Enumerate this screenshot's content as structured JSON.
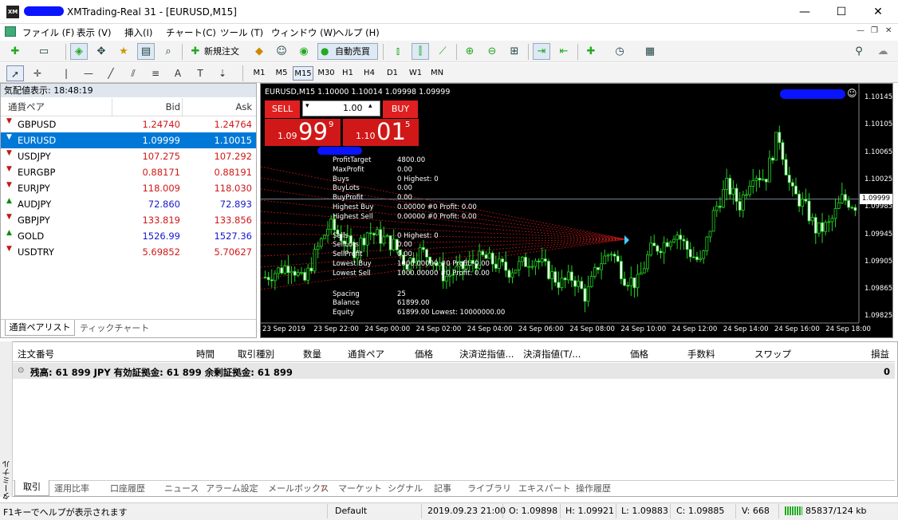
{
  "window": {
    "title": "XMTrading-Real 31 - [EURUSD,M15]",
    "app_icon": "XM",
    "minimize": "—",
    "maximize": "☐",
    "close": "✕"
  },
  "menu": [
    "ファイル (F)",
    "表示 (V)",
    "挿入(I)",
    "チャート(C)",
    "ツール (T)",
    "ウィンドウ (W)",
    "ヘルプ (H)"
  ],
  "toolbar": {
    "new_order": "新規注文",
    "auto_trading": "自動売買"
  },
  "timeframes": [
    "M1",
    "M5",
    "M15",
    "M30",
    "H1",
    "H4",
    "D1",
    "W1",
    "MN"
  ],
  "timeframe_selected": "M15",
  "market_watch": {
    "title": "気配値表示: 18:48:19",
    "col_symbol": "通貨ペア",
    "col_bid": "Bid",
    "col_ask": "Ask",
    "rows": [
      {
        "symbol": "GBPUSD",
        "bid": "1.24740",
        "ask": "1.24764",
        "dir": "down",
        "color": "red"
      },
      {
        "symbol": "EURUSD",
        "bid": "1.09999",
        "ask": "1.10015",
        "dir": "down",
        "color": "red",
        "selected": true
      },
      {
        "symbol": "USDJPY",
        "bid": "107.275",
        "ask": "107.292",
        "dir": "down",
        "color": "red"
      },
      {
        "symbol": "EURGBP",
        "bid": "0.88171",
        "ask": "0.88191",
        "dir": "down",
        "color": "red"
      },
      {
        "symbol": "EURJPY",
        "bid": "118.009",
        "ask": "118.030",
        "dir": "down",
        "color": "red"
      },
      {
        "symbol": "AUDJPY",
        "bid": "72.860",
        "ask": "72.893",
        "dir": "up",
        "color": "blue"
      },
      {
        "symbol": "GBPJPY",
        "bid": "133.819",
        "ask": "133.856",
        "dir": "down",
        "color": "red"
      },
      {
        "symbol": "GOLD",
        "bid": "1526.99",
        "ask": "1527.36",
        "dir": "up",
        "color": "blue"
      },
      {
        "symbol": "USDTRY",
        "bid": "5.69852",
        "ask": "5.70627",
        "dir": "down",
        "color": "red"
      }
    ],
    "tabs": [
      "通貨ペアリスト",
      "ティックチャート"
    ]
  },
  "chart": {
    "header": "EURUSD,M15  1.10000 1.10014 1.09998 1.09999",
    "sell_label": "SELL",
    "buy_label": "BUY",
    "lot": "1.00",
    "sell_small": "1.09",
    "sell_big": "99",
    "sell_sup": "9",
    "buy_small": "1.10",
    "buy_big": "01",
    "buy_sup": "5",
    "price_labels": [
      "1.10145",
      "1.10105",
      "1.10065",
      "1.10025",
      "1.09985",
      "1.09945",
      "1.09905",
      "1.09865",
      "1.09825"
    ],
    "current_price": "1.09999",
    "time_labels": [
      "23 Sep 2019",
      "23 Sep 22:00",
      "24 Sep 00:00",
      "24 Sep 02:00",
      "24 Sep 04:00",
      "24 Sep 06:00",
      "24 Sep 08:00",
      "24 Sep 10:00",
      "24 Sep 12:00",
      "24 Sep 14:00",
      "24 Sep 16:00",
      "24 Sep 18:00"
    ],
    "info": [
      [
        "ProfitTarget",
        "4800.00"
      ],
      [
        "MaxProfit",
        "0.00"
      ],
      [
        "Buys",
        "0  Highest: 0"
      ],
      [
        "BuyLots",
        "0.00"
      ],
      [
        "BuyProfit",
        "0.00"
      ],
      [
        "Highest Buy",
        "0.00000 #0  Profit: 0.00"
      ],
      [
        "Highest Sell",
        "0.00000 #0  Profit: 0.00"
      ],
      [
        "Sells",
        "0  Highest: 0"
      ],
      [
        "SellLots",
        "0.00"
      ],
      [
        "SellProfit",
        "0.00"
      ],
      [
        "Lowest Buy",
        "1000.00000 #0  Profit: 0.00"
      ],
      [
        "Lowest Sell",
        "1000.00000 #0  Profit: 0.00"
      ],
      [
        "Spacing",
        "25"
      ],
      [
        "Balance",
        "61899.00"
      ],
      [
        "Equity",
        "61899.00  Lowest: 10000000.00"
      ]
    ]
  },
  "chart_data": {
    "type": "candlestick",
    "symbol": "EURUSD",
    "timeframe": "M15",
    "ylim": [
      1.09815,
      1.10165
    ],
    "current": 1.09999,
    "ohlc_approx": [
      1.0988,
      1.0989,
      1.099,
      1.0987,
      1.0992,
      1.0996,
      1.0994,
      1.0992,
      1.0995,
      1.0994,
      1.0993,
      1.099,
      1.0992,
      1.0991,
      1.0988,
      1.0989,
      1.099,
      1.0991,
      1.099,
      1.0989,
      1.099,
      1.0991,
      1.0989,
      1.0987,
      1.0988,
      1.0985,
      1.099,
      1.0992,
      1.0988,
      1.0987,
      1.0992,
      1.0993,
      1.0995,
      1.0992,
      1.099,
      1.0998,
      1.1002,
      1.0999,
      1.1004,
      1.1003,
      1.101,
      1.1001,
      1.0999,
      1.0995,
      1.0996,
      1.1,
      1.0999
    ]
  },
  "terminal": {
    "headers": [
      "注文番号",
      "時間",
      "取引種別",
      "数量",
      "通貨ペア",
      "価格",
      "決済逆指値...",
      "決済指値(T/...",
      "価格",
      "手数料",
      "スワップ",
      "損益"
    ],
    "balance_line": "残高: 61 899 JPY  有効証拠金: 61 899  余剰証拠金: 61 899",
    "profit": "0",
    "side_label": "ターミナル",
    "tabs": [
      "取引",
      "運用比率",
      "口座履歴",
      "ニュース",
      "アラーム設定",
      "メールボックス",
      "マーケット",
      "シグナル",
      "記事",
      "ライブラリ",
      "エキスパート",
      "操作履歴"
    ],
    "mail_count": "7"
  },
  "status": {
    "help": "F1キーでヘルプが表示されます",
    "profile": "Default",
    "datetime": "2019.09.23 21:00",
    "open": "O: 1.09898",
    "high": "H: 1.09921",
    "low": "L: 1.09883",
    "close": "C: 1.09885",
    "volume": "V: 668",
    "traffic": "85837/124 kb"
  }
}
